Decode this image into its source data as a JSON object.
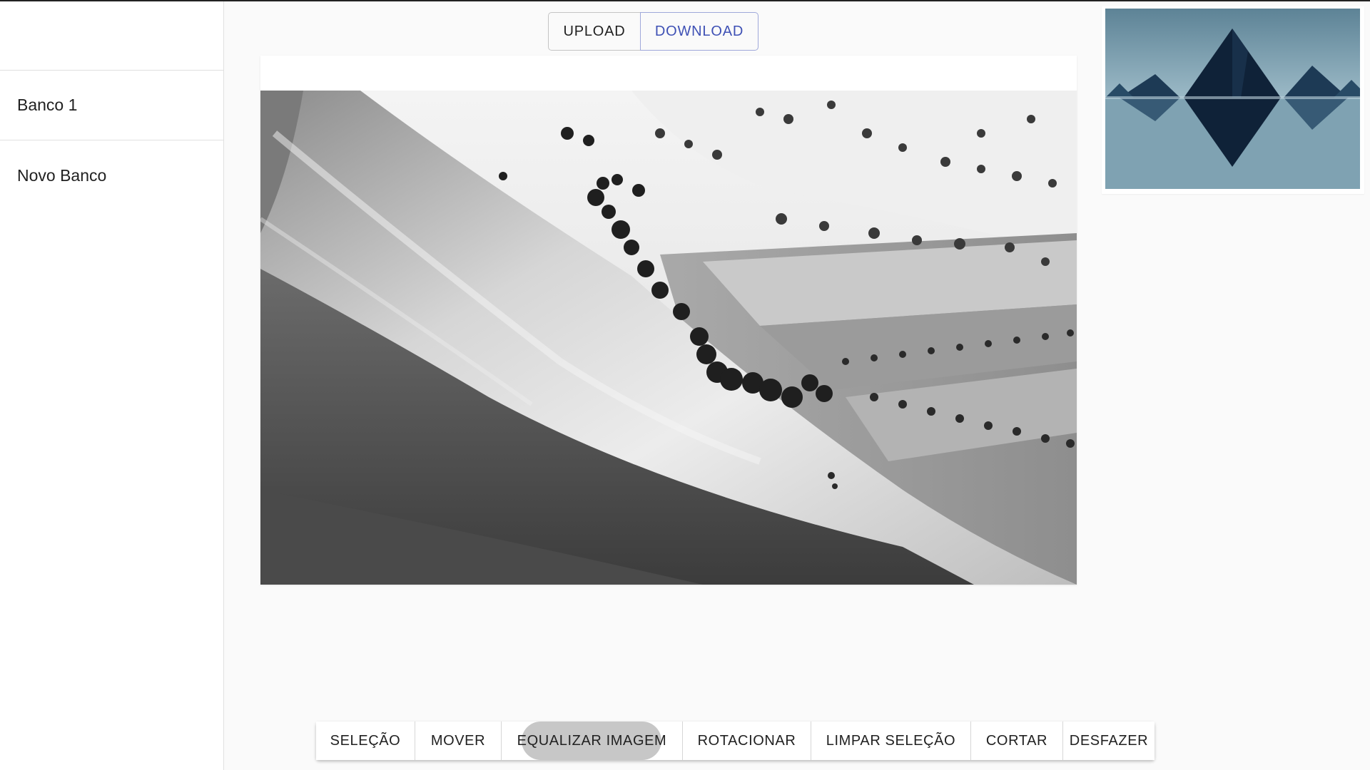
{
  "sidebar": {
    "items": [
      {
        "label": "Banco 1"
      },
      {
        "label": "Novo Banco"
      }
    ]
  },
  "topbar": {
    "upload_label": "UPLOAD",
    "download_label": "DOWNLOAD"
  },
  "toolbar": {
    "buttons": [
      {
        "label": "SELEÇÃO"
      },
      {
        "label": "MOVER"
      },
      {
        "label": "EQUALIZAR IMAGEM"
      },
      {
        "label": "ROTACIONAR"
      },
      {
        "label": "LIMPAR SELEÇÃO"
      },
      {
        "label": "CORTAR"
      },
      {
        "label": "DESFAZER"
      }
    ]
  },
  "colors": {
    "download_accent": "#3f51b5",
    "background": "#fafafa"
  }
}
